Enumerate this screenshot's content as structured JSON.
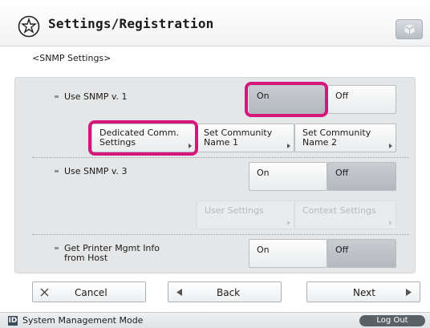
{
  "header": {
    "title": "Settings/Registration",
    "app_icon": "settings-gear-star-icon",
    "help_icon": "cube-icon"
  },
  "breadcrumb": "<SNMP Settings>",
  "snmp_v1": {
    "label": "Use SNMP v. 1",
    "on": "On",
    "off": "Off",
    "selected": "On",
    "dedicated_line1": "Dedicated Comm.",
    "dedicated_line2": "Settings",
    "community1_line1": "Set Community",
    "community1_line2": "Name 1",
    "community2_line1": "Set Community",
    "community2_line2": "Name 2"
  },
  "snmp_v3": {
    "label": "Use SNMP v. 3",
    "on": "On",
    "off": "Off",
    "user_settings": "User Settings",
    "context_settings": "Context Settings"
  },
  "printer_mgmt": {
    "label_line1": "Get Printer Mgmt Info",
    "label_line2": "from Host",
    "on": "On",
    "off": "Off"
  },
  "nav": {
    "cancel": "Cancel",
    "back": "Back",
    "next": "Next"
  },
  "status": {
    "mode": "System Management Mode",
    "logout": "Log Out"
  },
  "colors": {
    "highlight": "#d6177a",
    "panel": "#e4e6e8",
    "selected_button": "#bfc4c9"
  }
}
